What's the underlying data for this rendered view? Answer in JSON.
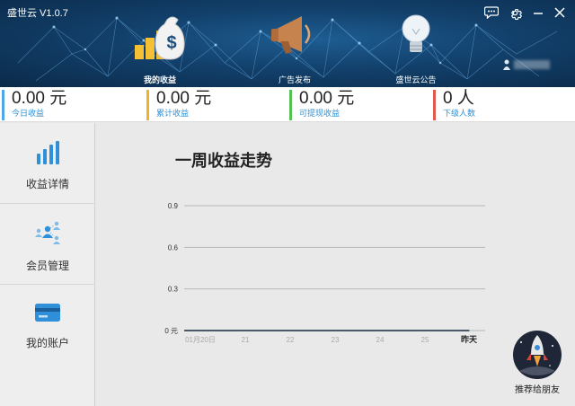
{
  "app": {
    "title": "盛世云 V1.0.7"
  },
  "window_icons": [
    "chat-icon",
    "gear-icon",
    "minimize-icon",
    "close-icon"
  ],
  "nav": [
    {
      "label": "我的收益",
      "icon": "money-bag-icon",
      "active": true
    },
    {
      "label": "广告发布",
      "icon": "megaphone-icon",
      "active": false
    },
    {
      "label": "盛世云公告",
      "icon": "lightbulb-icon",
      "active": false
    }
  ],
  "stats": [
    {
      "value": "0.00 元",
      "caption": "今日收益",
      "color": "#4fa7e6"
    },
    {
      "value": "0.00 元",
      "caption": "累计收益",
      "color": "#f0b323"
    },
    {
      "value": "0.00 元",
      "caption": "可提现收益",
      "color": "#55c155"
    },
    {
      "value": "0 人",
      "caption": "下级人数",
      "color": "#e05a4e"
    }
  ],
  "sidebar": [
    {
      "label": "收益详情",
      "icon": "bar-chart-icon"
    },
    {
      "label": "会员管理",
      "icon": "members-icon"
    },
    {
      "label": "我的账户",
      "icon": "card-icon"
    }
  ],
  "chart_data": {
    "type": "line",
    "title": "一周收益走势",
    "categories": [
      "01月20日",
      "21",
      "22",
      "23",
      "24",
      "25",
      "昨天"
    ],
    "series": [
      {
        "values": [
          0,
          0,
          0,
          0,
          0,
          0,
          0
        ],
        "color": "#4a5a68"
      }
    ],
    "y_ticks": [
      "0 元",
      "0.3",
      "0.6",
      "0.9"
    ],
    "ylim": [
      0,
      0.9
    ],
    "grid": true
  },
  "promo": {
    "label": "推荐给朋友",
    "icon": "rocket-icon"
  }
}
